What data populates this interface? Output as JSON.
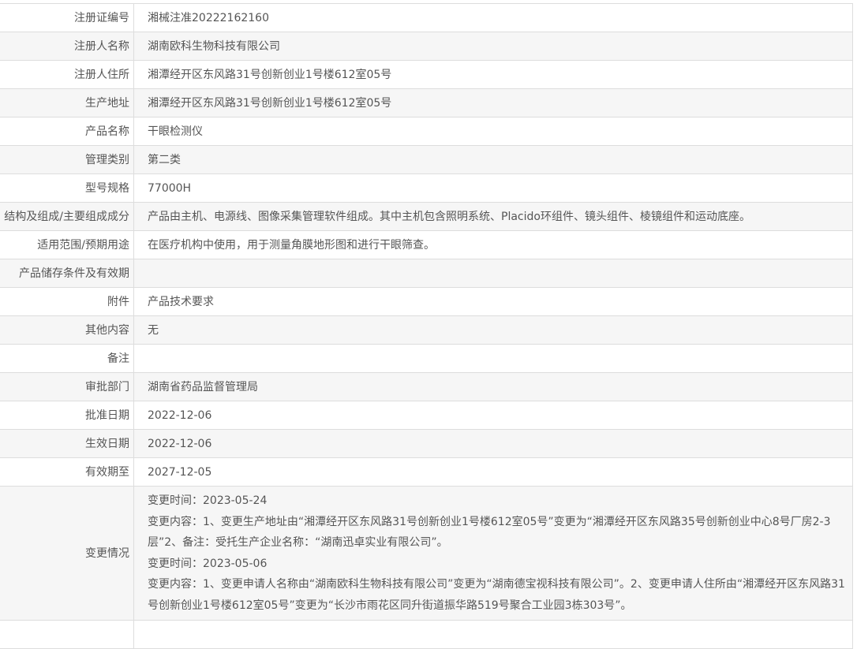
{
  "rows": [
    {
      "label": "注册证编号",
      "value": "湘械注准20222162160"
    },
    {
      "label": "注册人名称",
      "value": "湖南欧科生物科技有限公司"
    },
    {
      "label": "注册人住所",
      "value": "湘潭经开区东风路31号创新创业1号楼612室05号"
    },
    {
      "label": "生产地址",
      "value": "湘潭经开区东风路31号创新创业1号楼612室05号"
    },
    {
      "label": "产品名称",
      "value": "干眼检测仪"
    },
    {
      "label": "管理类别",
      "value": "第二类"
    },
    {
      "label": "型号规格",
      "value": "77000H"
    },
    {
      "label": "结构及组成/主要组成成分",
      "value": "产品由主机、电源线、图像采集管理软件组成。其中主机包含照明系统、Placido环组件、镜头组件、棱镜组件和运动底座。"
    },
    {
      "label": "适用范围/预期用途",
      "value": "在医疗机构中使用，用于测量角膜地形图和进行干眼筛查。"
    },
    {
      "label": "产品储存条件及有效期",
      "value": ""
    },
    {
      "label": "附件",
      "value": "产品技术要求"
    },
    {
      "label": "其他内容",
      "value": "无"
    },
    {
      "label": "备注",
      "value": ""
    },
    {
      "label": "审批部门",
      "value": "湖南省药品监督管理局"
    },
    {
      "label": "批准日期",
      "value": "2022-12-06"
    },
    {
      "label": "生效日期",
      "value": "2022-12-06"
    },
    {
      "label": "有效期至",
      "value": "2027-12-05"
    }
  ],
  "changes": {
    "label": "变更情况",
    "lines": [
      "变更时间：2023-05-24",
      "变更内容：1、变更生产地址由“湘潭经开区东风路31号创新创业1号楼612室05号”变更为“湘潭经开区东风路35号创新创业中心8号厂房2-3层”2、备注：受托生产企业名称：“湖南迅卓实业有限公司”。",
      "变更时间：2023-05-06",
      "变更内容：1、变更申请人名称由“湖南欧科生物科技有限公司”变更为“湖南德宝视科技有限公司”。2、变更申请人住所由“湘潭经开区东风路31号创新创业1号楼612室05号”变更为“长沙市雨花区同升街道振华路519号聚合工业园3栋303号”。"
    ]
  }
}
